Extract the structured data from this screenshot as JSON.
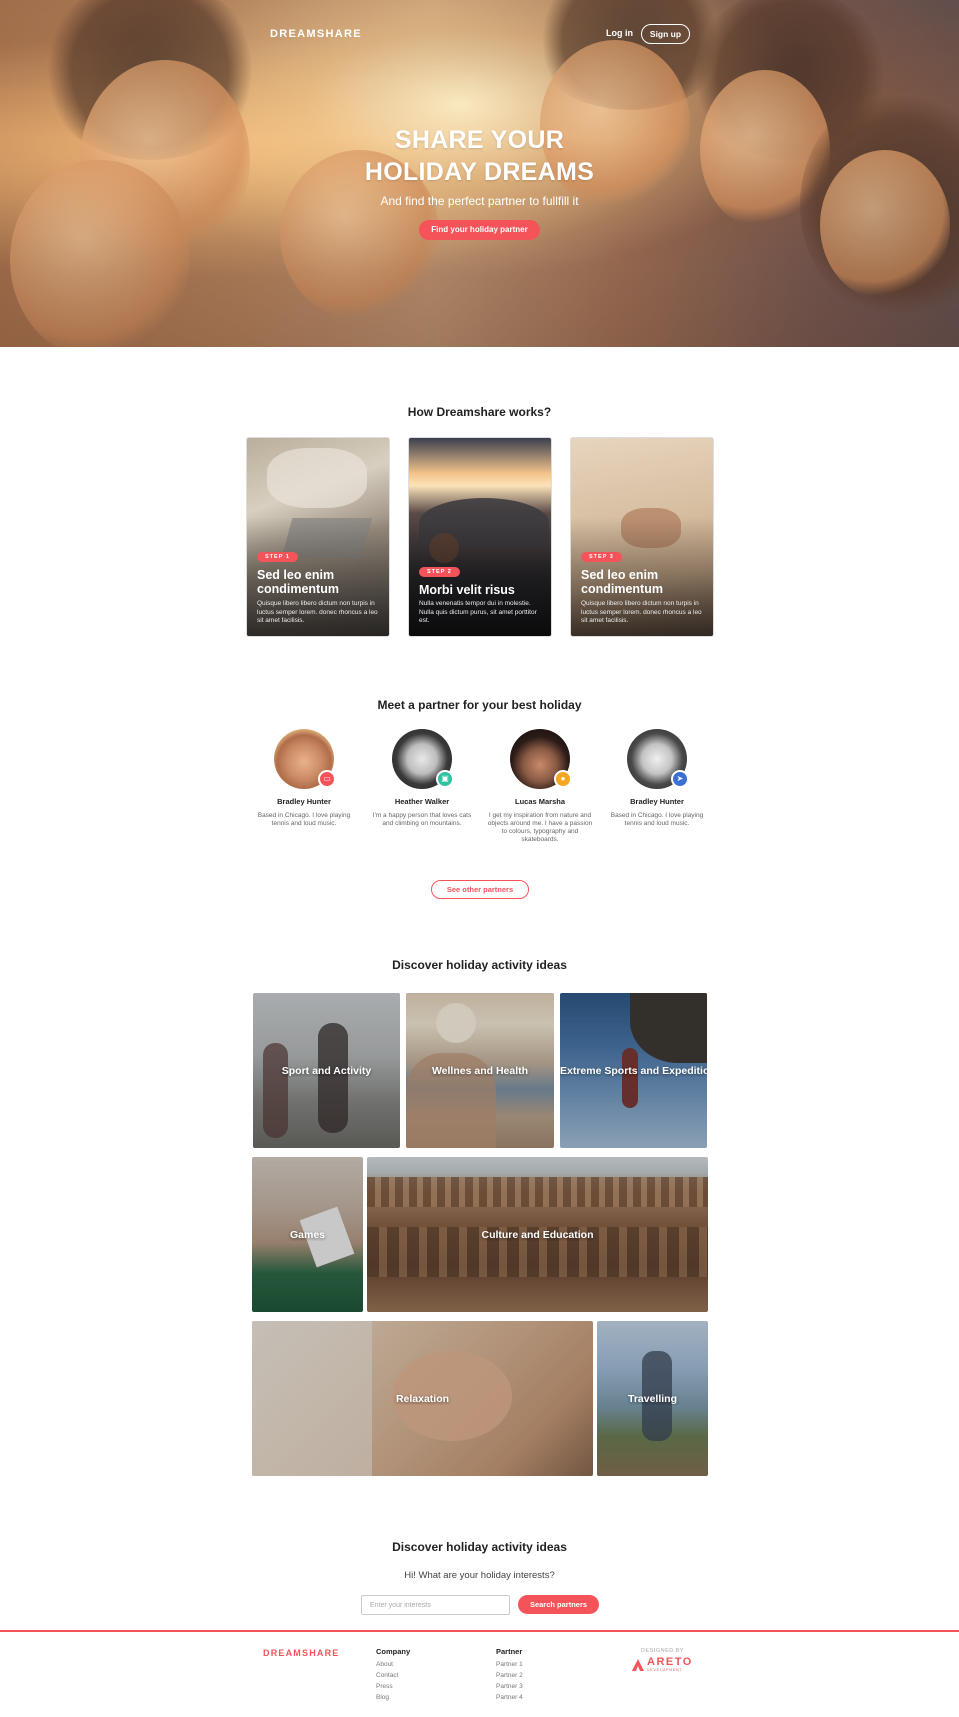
{
  "header": {
    "logo": "DREAMSHARE",
    "login_label": "Log in",
    "signup_label": "Sign up"
  },
  "hero": {
    "title_line1": "SHARE YOUR",
    "title_line2": "HOLIDAY DREAMS",
    "subtitle": "And find the perfect partner to fullfill it",
    "cta_label": "Find your holiday partner"
  },
  "how_it_works": {
    "title": "How Dreamshare works?",
    "steps": [
      {
        "badge": "STEP 1",
        "title": "Sed leo enim condimentum",
        "text": "Quisque libero libero dictum non turpis in luctus semper lorem. donec rhoncus a leo sit amet facilisis."
      },
      {
        "badge": "STEP 2",
        "title": "Morbi velit risus",
        "text": "Nulla venenatis tempor dui in molestie. Nulla quis dictum purus, sit amet porttitor est."
      },
      {
        "badge": "STEP 3",
        "title": "Sed leo enim condimentum",
        "text": "Quisque libero libero dictum non turpis in luctus semper lorem. donec rhoncus a leo sit amet facilisis."
      }
    ]
  },
  "partners": {
    "title": "Meet a partner for your best holiday",
    "items": [
      {
        "name": "Bradley Hunter",
        "description": "Based in Chicago. I love playing tennis and loud music.",
        "badge_icon": "monitor-icon",
        "badge_color": "#f5535a"
      },
      {
        "name": "Heather Walker",
        "description": "I'm a happy person that loves cats and climbing on mountains.",
        "badge_icon": "image-icon",
        "badge_color": "#2ec4a0"
      },
      {
        "name": "Lucas Marsha",
        "description": "I get my inspiration from nature and objects around me. I have a passion to colours, typography and skateboards.",
        "badge_icon": "user-icon",
        "badge_color": "#f5a623"
      },
      {
        "name": "Bradley Hunter",
        "description": "Based in Chicago. I love playing tennis and loud music.",
        "badge_icon": "send-icon",
        "badge_color": "#3b6fd4"
      }
    ],
    "more_label": "See other partners"
  },
  "activities": {
    "title": "Discover holiday activity ideas",
    "tiles": [
      {
        "label": "Sport and Activity"
      },
      {
        "label": "Wellnes and Health"
      },
      {
        "label": "Extreme Sports and Expedition"
      },
      {
        "label": "Games"
      },
      {
        "label": "Culture and Education"
      },
      {
        "label": "Relaxation"
      },
      {
        "label": "Travelling"
      }
    ]
  },
  "search": {
    "title": "Discover holiday activity ideas",
    "question": "Hi! What are your holiday interests?",
    "placeholder": "Enter your interests",
    "button_label": "Search partners"
  },
  "footer": {
    "logo": "DREAMSHARE",
    "company": {
      "heading": "Company",
      "links": [
        "About",
        "Contact",
        "Press",
        "Blog"
      ]
    },
    "partner": {
      "heading": "Partner",
      "links": [
        "Partner 1",
        "Partner 2",
        "Partner 3",
        "Partner 4"
      ]
    },
    "designed_by": "DESIGNED BY",
    "designer_name": "ARETO",
    "designer_sub": "DEVELOPMENT"
  },
  "colors": {
    "accent": "#f5535a"
  }
}
